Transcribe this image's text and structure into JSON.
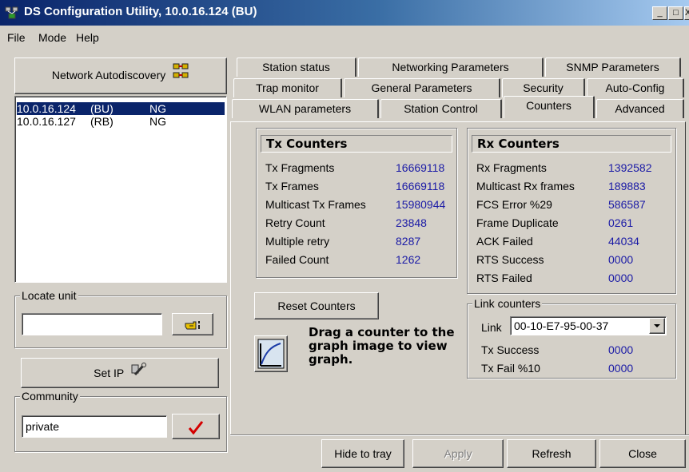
{
  "window": {
    "title": "DS Configuration Utility, 10.0.16.124  (BU)",
    "min_glyph": "_",
    "max_glyph": "□",
    "close_glyph": "X"
  },
  "menu": [
    "File",
    "Mode",
    "Help"
  ],
  "left": {
    "autodiscovery_label": "Network Autodiscovery",
    "devices": [
      {
        "ip": "10.0.16.124",
        "role": "(BU)",
        "type": "NG",
        "selected": true
      },
      {
        "ip": "10.0.16.127",
        "role": "(RB)",
        "type": "NG",
        "selected": false
      }
    ],
    "locate_label": "Locate unit",
    "locate_value": "",
    "set_ip_label": "Set IP",
    "community_label": "Community",
    "community_value": "private"
  },
  "tabs": {
    "row1": [
      "Station status",
      "Networking Parameters",
      "SNMP Parameters"
    ],
    "row2": [
      "Trap monitor",
      "General Parameters",
      "Security",
      "Auto-Config"
    ],
    "row3": [
      "WLAN parameters",
      "Station Control",
      "Counters",
      "Advanced"
    ],
    "active": "Counters"
  },
  "tx": {
    "title": "Tx Counters",
    "rows": [
      {
        "label": "Tx Fragments",
        "value": "16669118"
      },
      {
        "label": "Tx Frames",
        "value": "16669118"
      },
      {
        "label": "Multicast Tx Frames",
        "value": "15980944"
      },
      {
        "label": "Retry Count",
        "value": "23848"
      },
      {
        "label": "Multiple retry",
        "value": "8287"
      },
      {
        "label": "Failed Count",
        "value": "1262"
      }
    ]
  },
  "rx": {
    "title": "Rx Counters",
    "rows": [
      {
        "label": "Rx Fragments",
        "value": "1392582"
      },
      {
        "label": "Multicast Rx frames",
        "value": "189883"
      },
      {
        "label": "FCS Error  %29",
        "value": "586587"
      },
      {
        "label": "Frame Duplicate",
        "value": "0261"
      },
      {
        "label": "ACK Failed",
        "value": "44034"
      },
      {
        "label": "RTS Success",
        "value": "0000"
      },
      {
        "label": "RTS Failed",
        "value": "0000"
      }
    ]
  },
  "reset_label": "Reset Counters",
  "graph_hint": "Drag a counter to the graph image to view graph.",
  "link": {
    "group_label": "Link counters",
    "label": "Link",
    "selected": "00-10-E7-95-00-37",
    "tx_success_label": "Tx Success",
    "tx_success_value": "0000",
    "tx_fail_label": "Tx Fail   %10",
    "tx_fail_value": "0000"
  },
  "footer": {
    "hide_label": "Hide to tray",
    "apply_label": "Apply",
    "refresh_label": "Refresh",
    "close_label": "Close"
  },
  "colors": {
    "title_start": "#0a246a",
    "title_end": "#a6caf0",
    "face": "#d4d0c8",
    "value_text": "#1a1aa6",
    "selection": "#0a246a",
    "check": "#d40000"
  },
  "icons": [
    "app-icon",
    "network-icon",
    "pointing-hand-icon",
    "wrench-icon",
    "checkmark-icon",
    "graph-icon",
    "dropdown-arrow-icon"
  ]
}
